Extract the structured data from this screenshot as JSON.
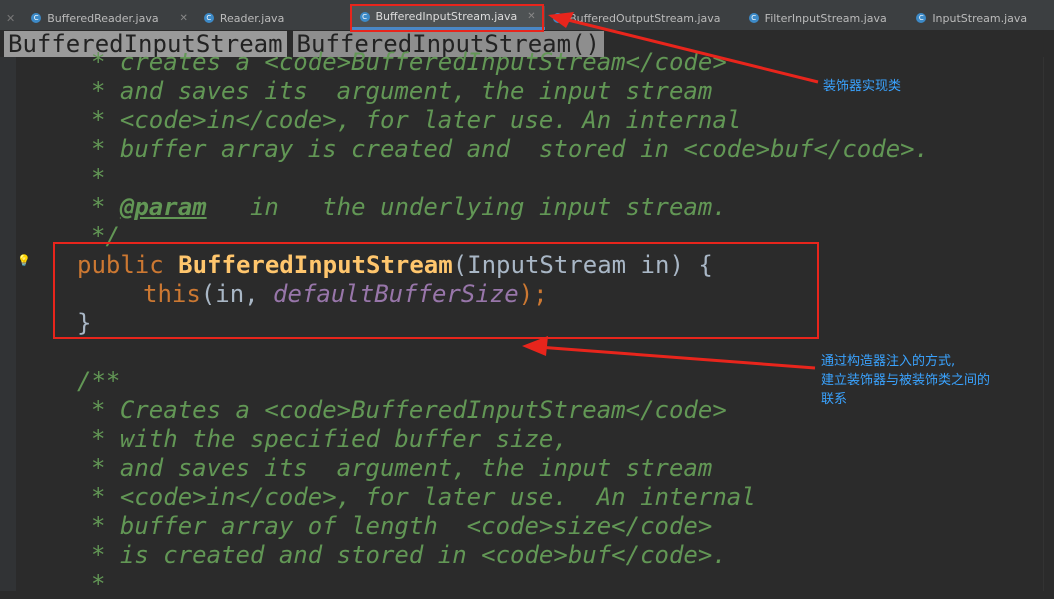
{
  "tabs": [
    {
      "label": "BufferedReader.java",
      "active": false
    },
    {
      "label": "Reader.java",
      "active": false
    },
    {
      "label": "BufferedInputStream.java",
      "active": true
    },
    {
      "label": "BufferedOutputStream.java",
      "active": false
    },
    {
      "label": "FilterInputStream.java",
      "active": false
    },
    {
      "label": "InputStream.java",
      "active": false
    }
  ],
  "breadcrumb": {
    "item1": "BufferedInputStream",
    "item2": "BufferedInputStream()"
  },
  "code": {
    "l1": "* creates a <code>BufferedInputStream</code>",
    "l2": "* and saves its  argument, the input stream",
    "l3": "* <code>in</code>, for later use. An internal",
    "l4": "* buffer array is created and  stored in <code>buf</code>.",
    "l5": "*",
    "l6_star": "* ",
    "l6_tag": "@param",
    "l6_rest": "   in   the underlying input stream.",
    "l7": "*/",
    "l8_kw": "public",
    "l8_fn": "BufferedInputStream",
    "l8_rest": "(InputStream in) {",
    "l9_kw": "this",
    "l9_rest": "(in, ",
    "l9_field": "defaultBufferSize",
    "l9_end": ");",
    "l10": "}",
    "l11": "/**",
    "l12": "* Creates a <code>BufferedInputStream</code>",
    "l13": "* with the specified buffer size,",
    "l14": "* and saves its  argument, the input stream",
    "l15": "* <code>in</code>, for later use.  An internal",
    "l16": "* buffer array of length  <code>size</code>",
    "l17": "* is created and stored in <code>buf</code>.",
    "l18": "*"
  },
  "annotations": {
    "note1": "装饰器实现类",
    "note2_line1": "通过构造器注入的方式,",
    "note2_line2": "建立装饰器与被装饰类之间的",
    "note2_line3": "联系"
  },
  "colors": {
    "highlight": "#e8251c",
    "note": "#3aa3ff",
    "comment": "#629755",
    "keyword": "#cc7832",
    "method": "#ffc66d"
  }
}
